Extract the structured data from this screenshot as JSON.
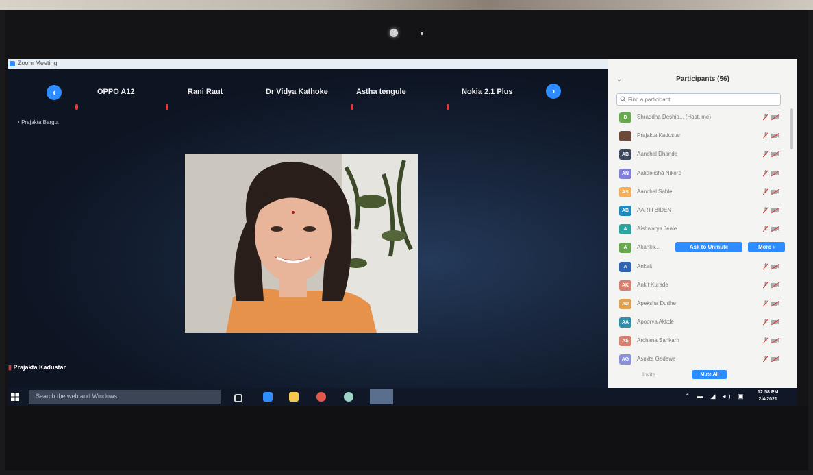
{
  "window": {
    "title": "Zoom Meeting"
  },
  "gallery_strip": {
    "prev_icon": "chevron-left",
    "next_icon": "chevron-right",
    "tiles": [
      "OPPO A12",
      "Rani Raut",
      "Dr Vidya Kathoke",
      "Astha tengule",
      "Nokia 2.1 Plus"
    ]
  },
  "speaker_label": "Prajakta Bargu..",
  "active_video_name": "Prajakta Kadustar",
  "participants_panel": {
    "title": "Participants (56)",
    "search_placeholder": "Find a participant",
    "participants": [
      {
        "initials": "D",
        "name": "Shraddha Deship... (Host, me)",
        "color": "#6aa84f"
      },
      {
        "initials": "",
        "name": "Prajakta Kadustar",
        "color": "#6b4a3a"
      },
      {
        "initials": "AB",
        "name": "Aanchal Dhande",
        "color": "#3d4a5e"
      },
      {
        "initials": "AN",
        "name": "Aakanksha Nikore",
        "color": "#7f7fd6"
      },
      {
        "initials": "AS",
        "name": "Aanchal Sable",
        "color": "#f0b060"
      },
      {
        "initials": "AB",
        "name": "AARTI BIDEN",
        "color": "#1f8ac0"
      },
      {
        "initials": "A",
        "name": "Aishwarya Jeale",
        "color": "#2aa6a0"
      },
      {
        "initials": "A",
        "name": "Akanks...",
        "color": "#6aa84f"
      },
      {
        "initials": "A",
        "name": "Ankait",
        "color": "#2e64b0"
      },
      {
        "initials": "AK",
        "name": "Ankit Kurade",
        "color": "#d88070"
      },
      {
        "initials": "AD",
        "name": "Apeksha Dudhe",
        "color": "#e0a050"
      },
      {
        "initials": "AA",
        "name": "Apoorva Akkde",
        "color": "#2f8fa8"
      },
      {
        "initials": "AS",
        "name": "Archana Sahkarh",
        "color": "#d88070"
      },
      {
        "initials": "AG",
        "name": "Asmita Gadewe",
        "color": "#8a8fd8"
      }
    ],
    "hover_actions": {
      "ask_to_unmute": "Ask to Unmute",
      "more": "More ›"
    },
    "footer": {
      "invite_label": "Invite",
      "mute_all_label": "Mute All"
    }
  },
  "taskbar": {
    "search_placeholder": "Search the web and Windows",
    "clock_time": "12:58 PM",
    "clock_date": "2/4/2021"
  }
}
